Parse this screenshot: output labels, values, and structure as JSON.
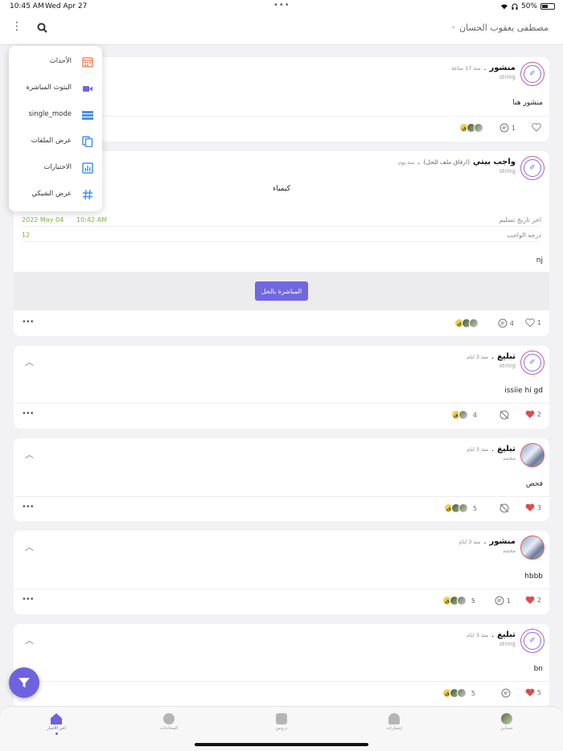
{
  "status_bar": {
    "time": "10:45 AM",
    "date": "Wed Apr 27",
    "battery": "50%",
    "battery_level": 0.5
  },
  "app_bar": {
    "title": "مصطفى يعقوب الحسان"
  },
  "menu": {
    "items": [
      {
        "label": "الأحداث",
        "icon": "calendar-icon",
        "color": "#f08b5a"
      },
      {
        "label": "البثوث المباشرة",
        "icon": "video-icon",
        "color": "#7068e0"
      },
      {
        "label": "single_mode",
        "icon": "list-mode-icon",
        "color": "#4a90e2"
      },
      {
        "label": "عرض الملفات",
        "icon": "files-icon",
        "color": "#4a90e2"
      },
      {
        "label": "الاختبارات",
        "icon": "chart-icon",
        "color": "#4a90e2"
      },
      {
        "label": "عرض الشبكي",
        "icon": "grid-hash-icon",
        "color": "#4a90e2"
      }
    ]
  },
  "posts": [
    {
      "type": "منشور",
      "ago": "منذ 17 ساعة",
      "sub": "string",
      "text": "منشور هنا",
      "comments": "1",
      "likes": "",
      "liked": false
    },
    {
      "type": "واجب بيتي",
      "attach": "(ارفاق ملف للحل)",
      "ago": "منذ يوم",
      "sub": "string",
      "subject": "كيمياء",
      "deadline_label": "اخر تاريخ تسليم",
      "deadline_date": "2022 May 04",
      "deadline_time": "10:42 AM",
      "grade_label": "درجه الواجب",
      "grade_value": "12",
      "text": "nj",
      "button": "المباشرة بالحل",
      "comments": "4",
      "likes": "1",
      "liked": false
    },
    {
      "type": "تبليغ",
      "ago": "منذ 3 ايام",
      "sub": "string",
      "text": "issiie hi gd",
      "seen": "4",
      "likes": "2",
      "liked": true
    },
    {
      "type": "تبليغ",
      "ago": "منذ 3 ايام",
      "sub": "محمد",
      "text": "فحص",
      "seen": "5",
      "likes": "3",
      "liked": true
    },
    {
      "type": "منشور",
      "ago": "منذ 3 ايام",
      "sub": "محمد",
      "text": "hbbb",
      "seen": "5",
      "comments": "1",
      "likes": "2",
      "liked": true
    },
    {
      "type": "تبليغ",
      "ago": "منذ 3 ايام",
      "sub": "string",
      "text": "bn",
      "seen": "5",
      "likes": "5",
      "liked": true
    }
  ],
  "tabs": [
    {
      "label": "اخر الأخبار",
      "active": true
    },
    {
      "label": "المحادثات",
      "active": false
    },
    {
      "label": "دروس",
      "active": false
    },
    {
      "label": "إشعارات",
      "active": false
    },
    {
      "label": "حسابي",
      "active": false
    }
  ],
  "colors": {
    "accent": "#6e63df",
    "like": "#e04b4b",
    "deadline": "#7cb342"
  }
}
